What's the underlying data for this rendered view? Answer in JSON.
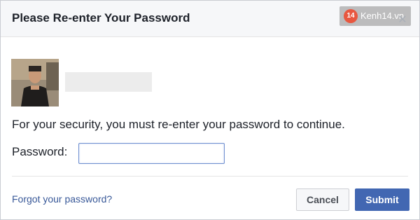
{
  "dialog": {
    "title": "Please Re-enter Your Password",
    "close_icon": "close-icon"
  },
  "watermark": {
    "logo_text": "14",
    "site": "Kenh14.vn"
  },
  "user": {
    "avatar": "user-avatar"
  },
  "body": {
    "message": "For your security, you must re-enter your password to continue.",
    "password_label": "Password:",
    "password_value": ""
  },
  "footer": {
    "forgot_link": "Forgot your password?",
    "cancel_label": "Cancel",
    "submit_label": "Submit"
  },
  "colors": {
    "accent": "#4267b2",
    "link": "#385898",
    "header_bg": "#f6f7f9"
  }
}
